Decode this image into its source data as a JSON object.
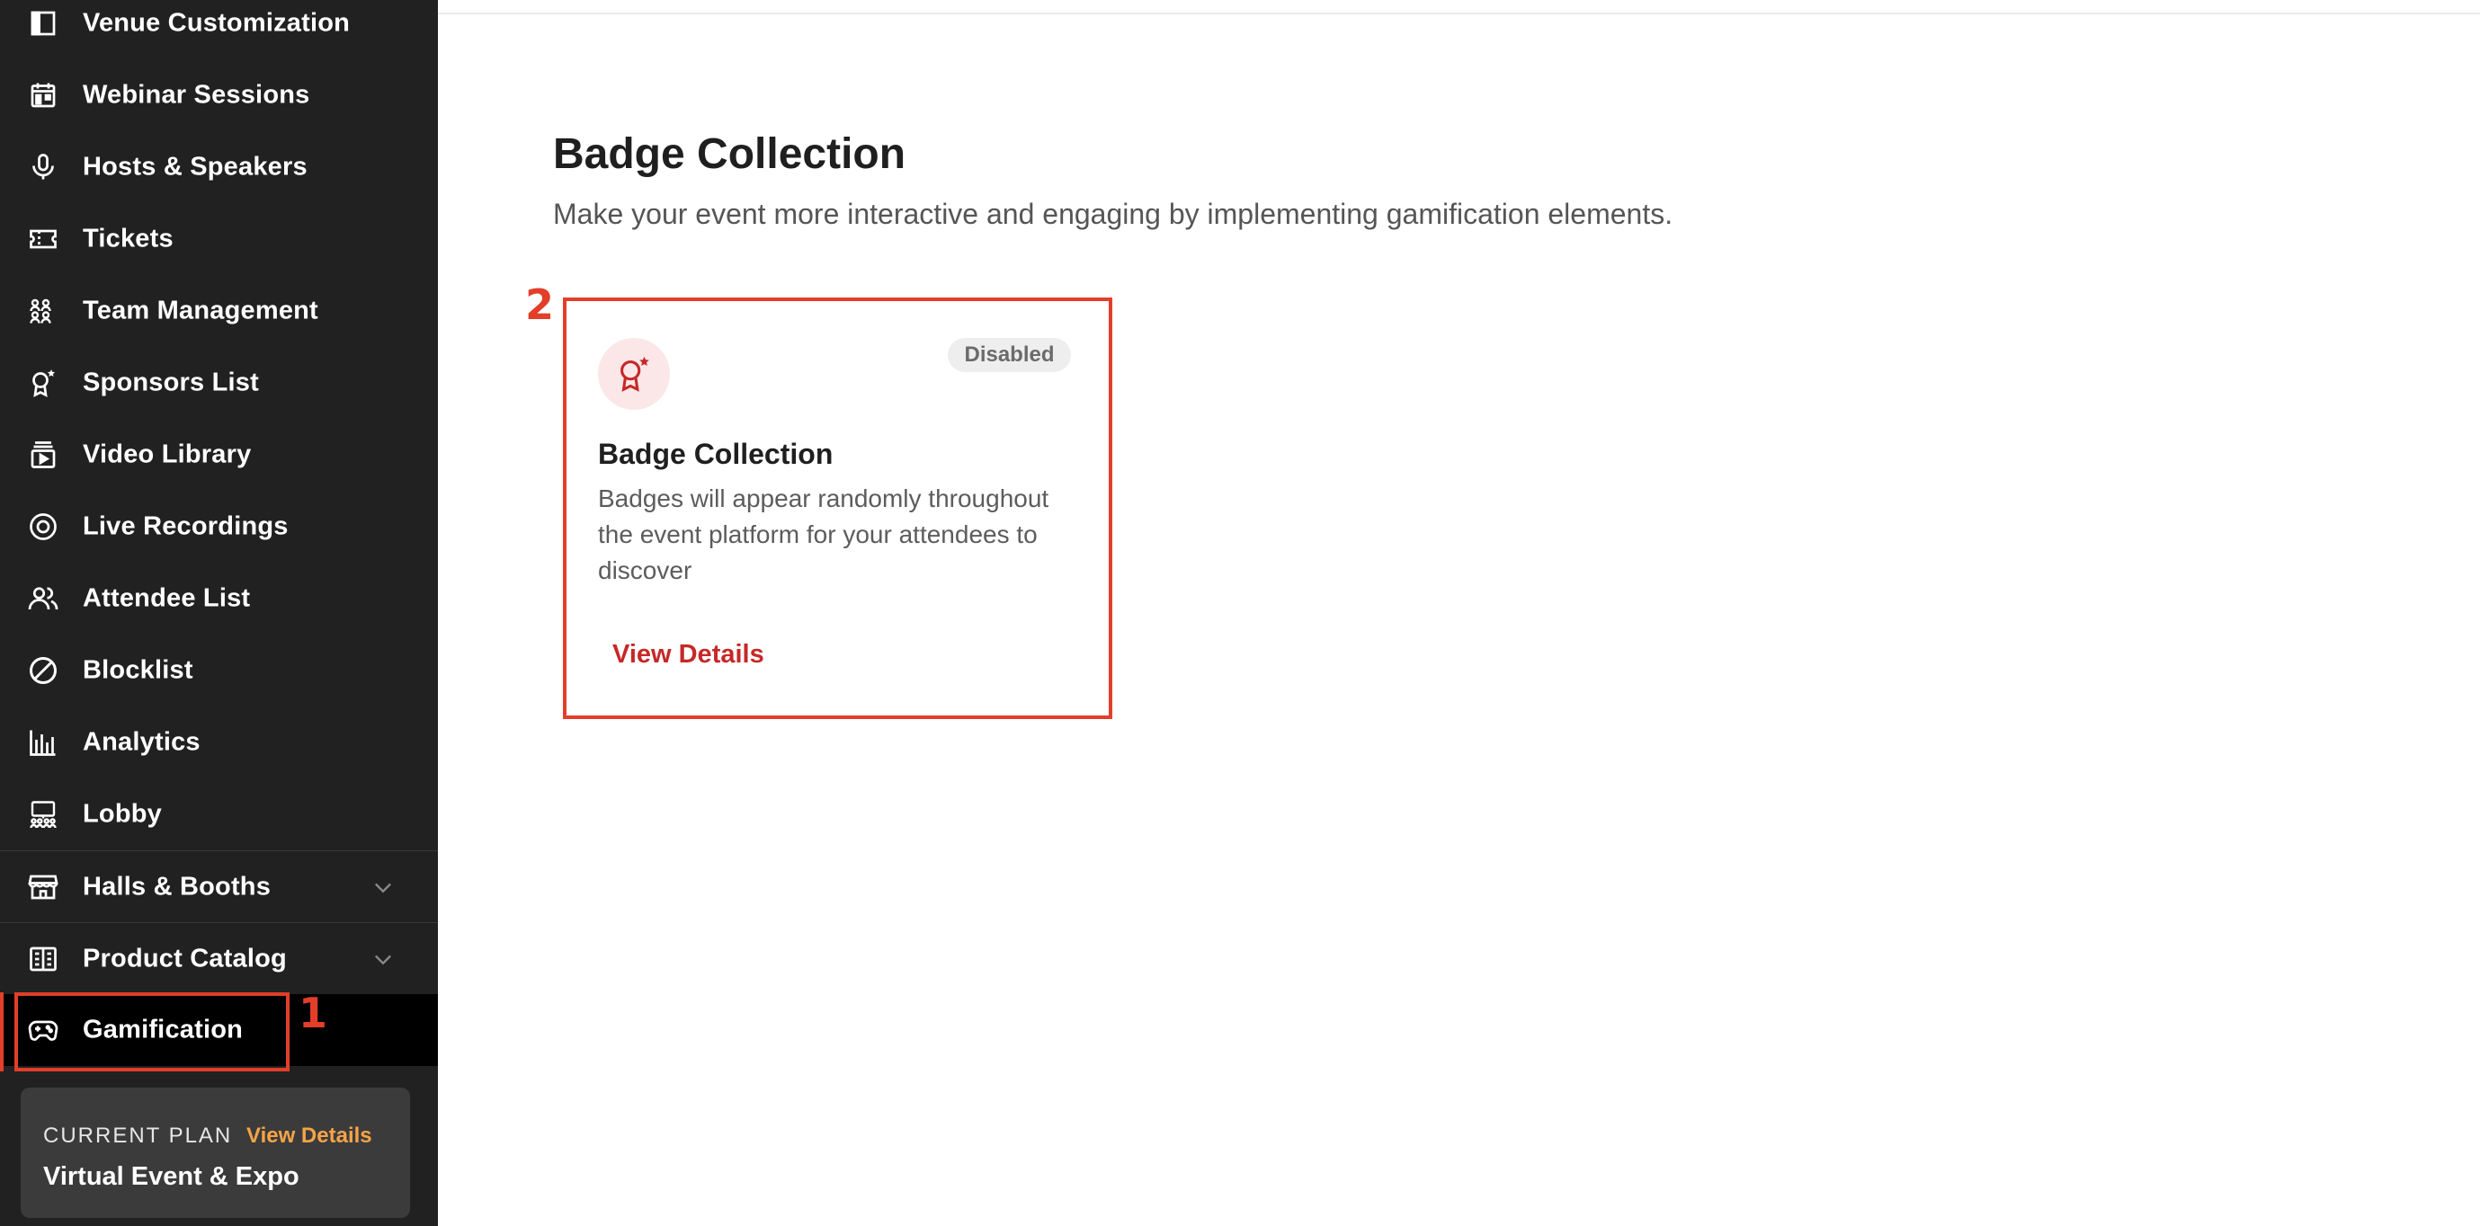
{
  "sidebar": {
    "items": [
      {
        "label": "Venue Customization",
        "icon": "layout-icon"
      },
      {
        "label": "Webinar Sessions",
        "icon": "calendar-icon"
      },
      {
        "label": "Hosts & Speakers",
        "icon": "microphone-icon"
      },
      {
        "label": "Tickets",
        "icon": "ticket-icon"
      },
      {
        "label": "Team Management",
        "icon": "team-icon"
      },
      {
        "label": "Sponsors List",
        "icon": "award-star-icon"
      },
      {
        "label": "Video Library",
        "icon": "video-library-icon"
      },
      {
        "label": "Live Recordings",
        "icon": "record-icon"
      },
      {
        "label": "Attendee List",
        "icon": "users-icon"
      },
      {
        "label": "Blocklist",
        "icon": "block-icon"
      },
      {
        "label": "Analytics",
        "icon": "bar-chart-icon"
      },
      {
        "label": "Lobby",
        "icon": "lobby-icon"
      },
      {
        "label": "Halls & Booths",
        "icon": "store-icon",
        "expandable": true
      },
      {
        "label": "Product Catalog",
        "icon": "catalog-icon",
        "expandable": true
      },
      {
        "label": "Gamification",
        "icon": "gamepad-icon",
        "active": true
      }
    ],
    "plan": {
      "label": "CURRENT PLAN",
      "link": "View Details",
      "name": "Virtual Event & Expo"
    }
  },
  "main": {
    "title": "Badge Collection",
    "subtitle": "Make your event more interactive and engaging by implementing gamification elements.",
    "card": {
      "icon": "badge-award-icon",
      "status": "Disabled",
      "title": "Badge Collection",
      "description": "Badges will appear randomly throughout the event platform for your attendees to discover",
      "link": "View Details"
    }
  },
  "annotations": [
    "1",
    "2"
  ],
  "colors": {
    "sidebar_bg": "#212121",
    "active_bg": "#000000",
    "accent_red": "#c62828",
    "annotation_red": "#e23e2a",
    "plan_link": "#f5a447"
  }
}
